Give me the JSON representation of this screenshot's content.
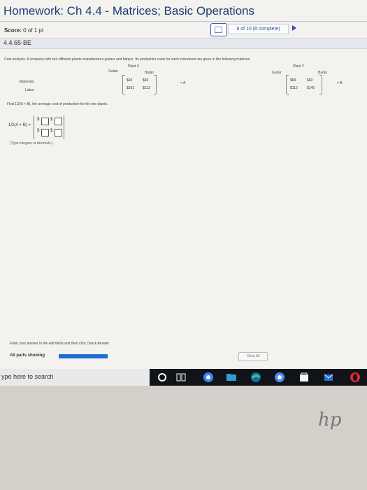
{
  "header": {
    "title": "Homework: Ch 4.4 - Matrices; Basic Operations",
    "score_label": "Score:",
    "score_value": "0 of 1 pt",
    "progress_text": "9 of 10 (8 complete)"
  },
  "question": {
    "id": "4.4.65-BE",
    "prompt": "Cost analysis. A company with two different plants manufactures guitars and banjos. Its production costs for each instrument are given in the following matrices.",
    "plant_x": {
      "label": "Plant X",
      "col1": "Guitar",
      "col2": "Banjo",
      "row1_label": "Materials",
      "row2_label": "Labor",
      "row1": [
        "$40",
        "$40"
      ],
      "row2": [
        "$101",
        "$113"
      ],
      "name": "= A"
    },
    "plant_y": {
      "label": "Plant Y",
      "col1": "Guitar",
      "col2": "Banjo",
      "row1": [
        "$69",
        "$60"
      ],
      "row2": [
        "$112",
        "$140"
      ],
      "name": "= B"
    },
    "find_text": "Find 1/2(A + B), the average cost of production for the two plants.",
    "answer_label": "1/2(A + B) =",
    "answer_dollar": "$",
    "hint": "(Type integers or decimals.)"
  },
  "footer": {
    "instruction": "Enter your answer in the edit fields and then click Check Answer.",
    "parts_showing": "All parts showing",
    "clear_all": "Clear All"
  },
  "taskbar": {
    "search_placeholder": "ype here to search"
  },
  "laptop": {
    "brand": "hp"
  },
  "colors": {
    "title": "#1b3c73",
    "accent": "#1f6bd4"
  }
}
